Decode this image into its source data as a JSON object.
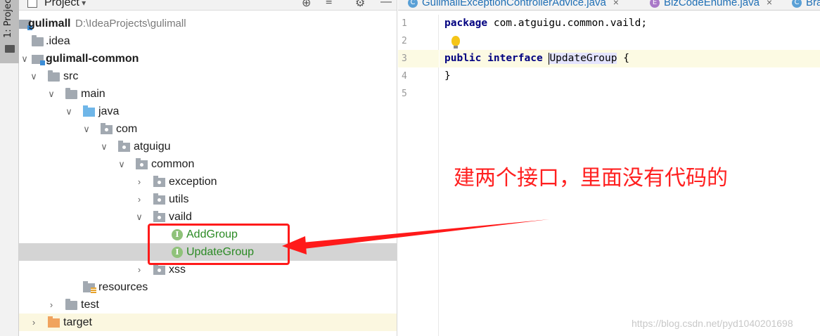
{
  "tool_window": {
    "tab_label": "1: Project"
  },
  "project_panel": {
    "title": "Project",
    "tree": [
      {
        "label": "gulimall",
        "path": "D:\\IdeaProjects\\gulimall",
        "icon": "module-icon",
        "bold": true
      },
      {
        "label": ".idea",
        "icon": "folder-icon"
      },
      {
        "label": "gulimall-common",
        "icon": "module-icon",
        "bold": true
      },
      {
        "label": "src",
        "icon": "folder-icon"
      },
      {
        "label": "main",
        "icon": "folder-icon"
      },
      {
        "label": "java",
        "icon": "source-root-icon"
      },
      {
        "label": "com",
        "icon": "package-icon"
      },
      {
        "label": "atguigu",
        "icon": "package-icon"
      },
      {
        "label": "common",
        "icon": "package-icon"
      },
      {
        "label": "exception",
        "icon": "package-icon"
      },
      {
        "label": "utils",
        "icon": "package-icon"
      },
      {
        "label": "vaild",
        "icon": "package-icon"
      },
      {
        "label": "AddGroup",
        "icon": "interface-icon"
      },
      {
        "label": "UpdateGroup",
        "icon": "interface-icon"
      },
      {
        "label": "xss",
        "icon": "package-icon"
      },
      {
        "label": "resources",
        "icon": "resources-folder-icon"
      },
      {
        "label": "test",
        "icon": "folder-icon"
      },
      {
        "label": "target",
        "icon": "excluded-folder-icon"
      }
    ]
  },
  "editor": {
    "tabs": [
      {
        "label": "GulimallExceptionControllerAdvice.java",
        "icon": "class-icon"
      },
      {
        "label": "BizCodeEnume.java",
        "icon": "enum-icon"
      },
      {
        "label": "Bra",
        "icon": "class-icon"
      }
    ],
    "line_numbers": [
      "1",
      "2",
      "3",
      "4",
      "5"
    ],
    "code": {
      "line1_kw": "package",
      "line1_rest": " com.atguigu.common.vaild;",
      "line3_kw1": "public",
      "line3_kw2": "interface",
      "line3_ident": "UpdateGroup",
      "line3_rest": " {",
      "line4": "}"
    }
  },
  "annotation": {
    "callout_text": "建两个接口，里面没有代码的",
    "color": "#ff1a1a"
  },
  "watermark": "https://blog.csdn.net/pyd1040201698"
}
